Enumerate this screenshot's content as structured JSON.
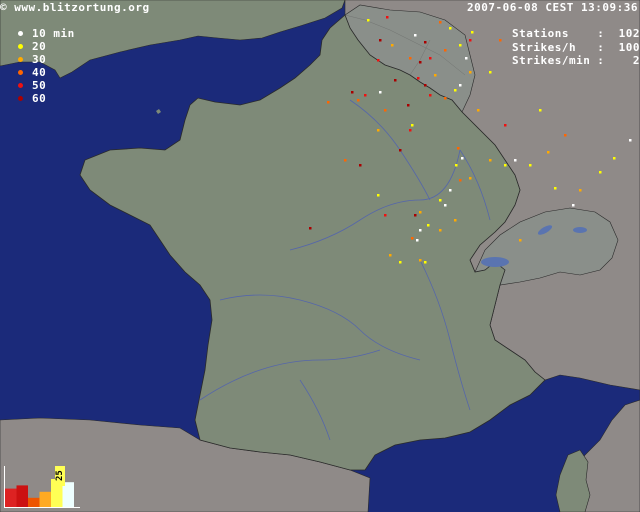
{
  "header": {
    "credit_icon": "copyright-symbol",
    "credit_text": "© www.blitzortung.org",
    "timestamp": "2007-06-08 CEST 13:09:36"
  },
  "stats": [
    {
      "label": "Stations",
      "value": ":  102"
    },
    {
      "label": "Strikes/h",
      "value": ":  100"
    },
    {
      "label": "Strikes/min",
      "value": ":    2"
    }
  ],
  "legend": [
    {
      "label": "10 min",
      "color": "#ffffff"
    },
    {
      "label": "20",
      "color": "#ffff00"
    },
    {
      "label": "30",
      "color": "#ffaa00"
    },
    {
      "label": "40",
      "color": "#ff6600"
    },
    {
      "label": "50",
      "color": "#ee1111"
    },
    {
      "label": "60",
      "color": "#aa0000"
    }
  ],
  "histogram": {
    "peak_label": "25",
    "bars": [
      {
        "color": "#dd2222",
        "level": 0.46
      },
      {
        "color": "#cc1111",
        "level": 0.54
      },
      {
        "color": "#ee5500",
        "level": 0.23
      },
      {
        "color": "#ffaa22",
        "level": 0.38
      },
      {
        "color": "#ffff55",
        "level": 0.7
      },
      {
        "color": "#eeffff",
        "level": 0.62
      }
    ]
  },
  "colors": {
    "sea": "#1b2a7a",
    "land": "#7e8a78",
    "land_neighbor": "#8f8a88",
    "border": "#333333",
    "river": "#5566aa",
    "lake": "#5a74b0"
  }
}
